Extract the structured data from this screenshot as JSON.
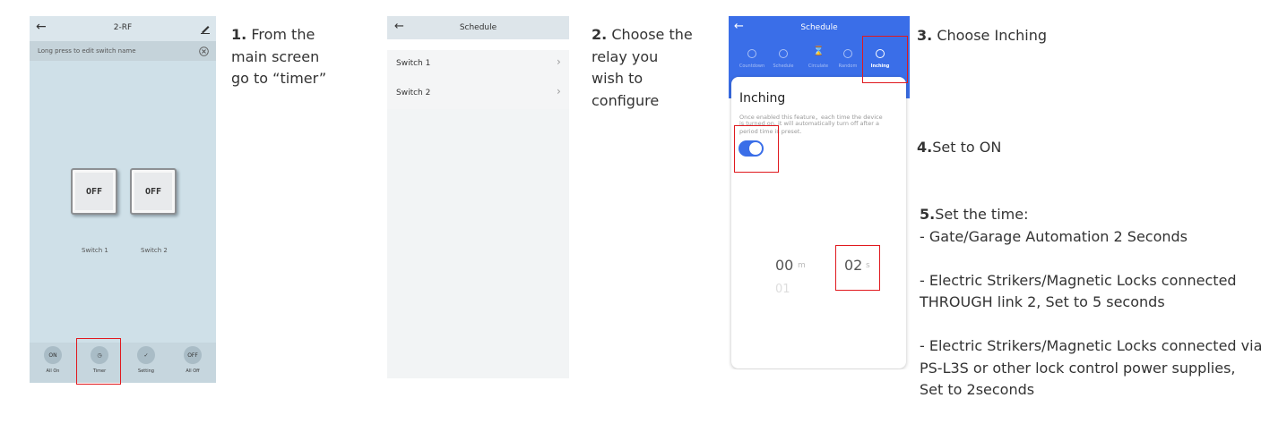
{
  "phone1": {
    "title": "2-RF",
    "back_icon": "arrow-left-icon",
    "edit_icon": "pencil-icon",
    "hint": "Long press to edit switch name",
    "close_icon": "circle-x-icon",
    "switches": [
      {
        "state": "OFF",
        "label": "Switch 1"
      },
      {
        "state": "OFF",
        "label": "Switch 2"
      }
    ],
    "bottom_bar": [
      {
        "icon_text": "ON",
        "label": "All On"
      },
      {
        "icon_text": "◷",
        "label": "Timer"
      },
      {
        "icon_text": "✓",
        "label": "Setting"
      },
      {
        "icon_text": "OFF",
        "label": "All Off"
      }
    ]
  },
  "phone2": {
    "title": "Schedule",
    "items": [
      {
        "label": "Switch 1"
      },
      {
        "label": "Switch 2"
      }
    ]
  },
  "phone3": {
    "title": "Schedule",
    "tabs": [
      "Countdown",
      "Schedule",
      "Circulate",
      "Random",
      "Inching"
    ],
    "heading": "Inching",
    "description_line1": "Once enabled this feature，each time the device",
    "description_line2": "is turned on, it will automatically turn off after a",
    "description_line3": "period time is preset.",
    "toggle_on": true,
    "minutes": "00",
    "minutes_unit": "m",
    "seconds": "02",
    "seconds_unit": "s",
    "next_minute": "01"
  },
  "steps": {
    "s1_num": "1.",
    "s1_line1": "From the",
    "s1_line2": "main screen",
    "s1_line3": "go to “timer”",
    "s2_num": "2.",
    "s2_line1": "Choose the",
    "s2_line2": "relay you",
    "s2_line3": "wish to",
    "s2_line4": "configure",
    "s3_num": "3.",
    "s3_text": "Choose Inching",
    "s4_num": "4.",
    "s4_text": "Set to ON",
    "s5_num": "5.",
    "s5_text": "Set the time:",
    "s5_a": "- Gate/Garage Automation 2 Seconds",
    "s5_b1": "- Electric Strikers/Magnetic Locks connected",
    "s5_b2": "THROUGH link 2, Set to 5 seconds",
    "s5_c1": "- Electric Strikers/Magnetic Locks connected via",
    "s5_c2": "PS-L3S or other lock control power supplies,",
    "s5_c3": "Set to 2seconds"
  },
  "colors": {
    "highlight": "#e0191e",
    "accent_blue": "#3a6ee8"
  }
}
